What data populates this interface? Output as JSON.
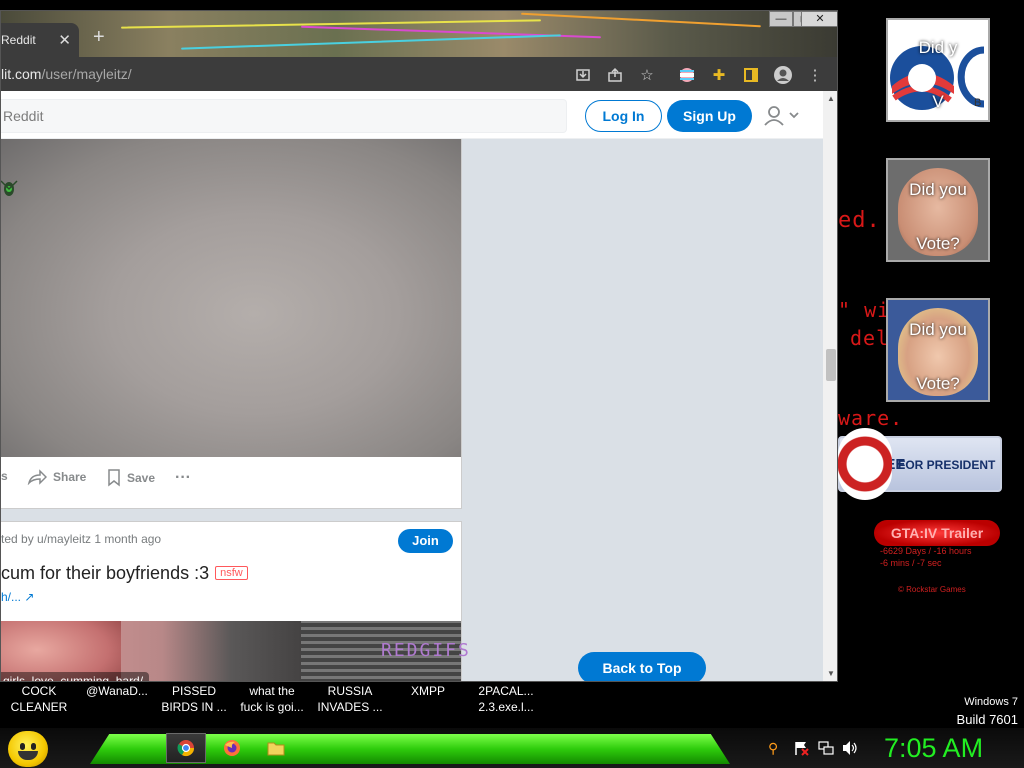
{
  "browser": {
    "tab_title": "Reddit",
    "tab_close": "✕",
    "new_tab": "+",
    "window_controls": [
      "—",
      "▢",
      "✕"
    ],
    "url_host": "lit.com",
    "url_path": "/user/mayleitz/",
    "toolbar_icons": [
      "install-icon",
      "share-icon",
      "star-icon",
      "flag-icon",
      "extensions-icon",
      "sidebar-icon",
      "profile-icon",
      "menu-icon"
    ]
  },
  "reddit": {
    "search_placeholder": "Reddit",
    "login_label": "Log In",
    "signup_label": "Sign Up",
    "post1": {
      "actions": [
        {
          "label": "s",
          "icon": "comments-icon"
        },
        {
          "label": "Share",
          "icon": "share-icon"
        },
        {
          "label": "Save",
          "icon": "bookmark-icon"
        },
        {
          "label": "···",
          "icon": "more-icon"
        }
      ]
    },
    "post2": {
      "meta": "ted by u/mayleitz 1 month ago",
      "join_label": "Join",
      "title": "cum for their boyfriends :3",
      "nsfw": "nsfw",
      "link": "h/...",
      "watermark": "REDGIFS",
      "overlay_url": "girls_love_cumming_hard/"
    },
    "back_to_top": "Back to Top"
  },
  "desktop": {
    "red_text": [
      "ed.",
      "\" wi",
      "del",
      "ware."
    ],
    "gadgets": [
      {
        "top_text": "Did y",
        "bottom_text": "V"
      },
      {
        "top_text": "Did you",
        "bottom_text": "Vote?"
      },
      {
        "top_text": "Did you",
        "bottom_text": "Vote?"
      }
    ],
    "huckabee": {
      "name": "CKABEE",
      "for": "FOR PRESIDENT"
    },
    "gta": {
      "label": "GTA:IV  Trailer",
      "line1": "-6629 Days / -16 hours",
      "line2": "-6 mins / -7 sec",
      "credit": "© Rockstar Games"
    },
    "windows_label": "Windows 7",
    "build_label": "Build 7601",
    "icons": [
      {
        "line1": "COCK",
        "line2": "CLEANER"
      },
      {
        "line1": "@WanaD...",
        "line2": ""
      },
      {
        "line1": "PISSED",
        "line2": "BIRDS IN ..."
      },
      {
        "line1": "what the",
        "line2": "fuck is goi..."
      },
      {
        "line1": "RUSSIA",
        "line2": "INVADES ..."
      },
      {
        "line1": "XMPP",
        "line2": ""
      },
      {
        "line1": "2PACAL...",
        "line2": "2.3.exe.l..."
      }
    ]
  },
  "taskbar": {
    "clock": "7:05 AM",
    "apps": [
      "chrome-icon",
      "firefox-icon",
      "folder-icon"
    ],
    "tray": [
      "search-icon",
      "flag-icon",
      "network-icon",
      "volume-icon"
    ]
  },
  "colors": {
    "reddit_blue": "#0079d3",
    "clock_green": "#22ee22",
    "taskbar_green": "#2ecc0c",
    "desktop_red": "#d81818"
  }
}
